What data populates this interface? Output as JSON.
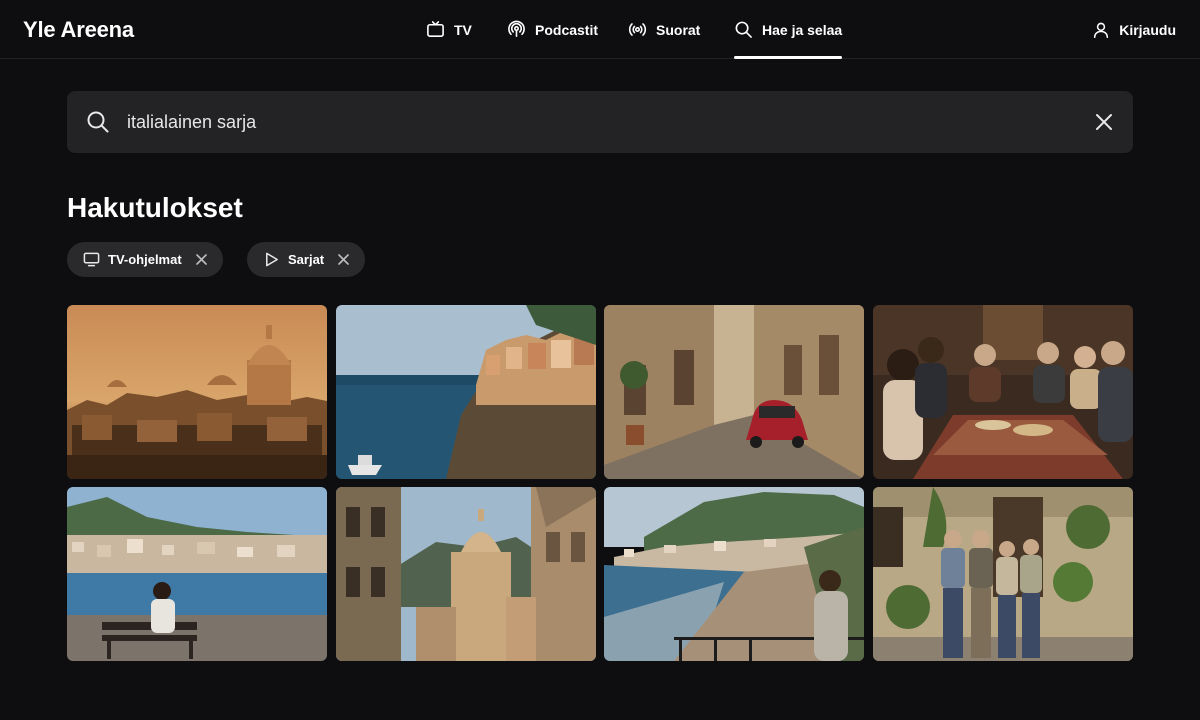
{
  "header": {
    "logo": "Yle Areena",
    "nav": [
      {
        "label": "TV",
        "icon": "tv-icon"
      },
      {
        "label": "Podcastit",
        "icon": "podcast-icon"
      },
      {
        "label": "Suorat",
        "icon": "live-icon"
      },
      {
        "label": "Hae ja selaa",
        "icon": "search-icon",
        "active": true
      }
    ],
    "login_label": "Kirjaudu"
  },
  "search": {
    "value": "italialainen sarja"
  },
  "results_title": "Hakutulokset",
  "filters": [
    {
      "label": "TV-ohjelmat",
      "icon": "monitor-icon"
    },
    {
      "label": "Sarjat",
      "icon": "play-icon"
    }
  ],
  "results": [
    {
      "scene": "city-domes-sunset"
    },
    {
      "scene": "coastal-cliff-village"
    },
    {
      "scene": "street-red-car"
    },
    {
      "scene": "family-dinner"
    },
    {
      "scene": "seaside-bench"
    },
    {
      "scene": "cathedral-street"
    },
    {
      "scene": "beach-woman"
    },
    {
      "scene": "family-courtyard"
    }
  ],
  "colors": {
    "background": "#0e0e10",
    "search_field": "#232326",
    "chip": "#2a2a2d"
  }
}
